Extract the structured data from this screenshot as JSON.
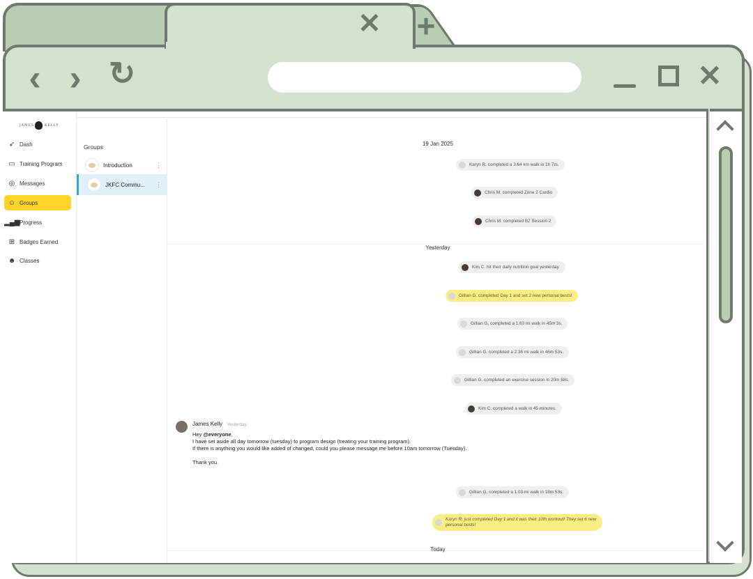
{
  "browser": {
    "tab_close_icon": "close-icon",
    "new_tab_icon": "plus-icon",
    "back_icon": "arrow-left-icon",
    "forward_icon": "arrow-right-icon",
    "reload_icon": "reload-icon",
    "colors": {
      "frame": "#d4e1ce",
      "tab_inactive": "#b9cdb2",
      "outline": "#6d7a6c"
    }
  },
  "app": {
    "logo": {
      "left": "JAMES",
      "right": "KELLY"
    },
    "nav": [
      {
        "label": "Dash",
        "icon": "rocket-icon"
      },
      {
        "label": "Training Program",
        "icon": "folder-icon"
      },
      {
        "label": "Messages",
        "icon": "chat-icon"
      },
      {
        "label": "Groups",
        "icon": "users-icon",
        "active": true
      },
      {
        "label": "Progress",
        "icon": "bar-chart-icon"
      },
      {
        "label": "Badges Earned",
        "icon": "grid-icon"
      },
      {
        "label": "Classes",
        "icon": "people-icon"
      }
    ],
    "accent": "#ffd32a",
    "groups": {
      "title": "Groups",
      "items": [
        {
          "name": "Introduction",
          "selected": false
        },
        {
          "name": "JKFC Commu...",
          "selected": true
        }
      ]
    },
    "feed": {
      "dates": [
        "19 Jan 2025",
        "Yesterday",
        "Today"
      ],
      "activities": [
        "Karyn R. completed a 3.64 km walk in 1h 7m.",
        "Chris M. completed Zone 2 Cardio",
        "Chris M. completed B7 Session 2",
        "Kim C. hit their daily nutrition goal yesterday.",
        "Gillian G. completed Day 1 and set 2 new personal bests!",
        "Gillian G. completed a 1.63 mi walk in 45m 3s.",
        "Gillian G. completed a 2.36 mi walk in 46m 53s.",
        "Gillian G. completed an exercise session in 20m 58s.",
        "Kim C. completed a walk in 45 minutes.",
        "Gillian G. completed a 1.03 mi walk in 18m 53s.",
        "Karyn R. just completed Day 1 and it was their 10th workout! They set 6 new personal bests!"
      ],
      "message": {
        "author": "James Kelly",
        "time": "Yesterday",
        "greeting_prefix": "Hey ",
        "mention": "@everyone",
        "greeting_suffix": ",",
        "line1": "I have set aside all day tomorrow (tuesday) to program design (treating your training program).",
        "line2": "If there is anything you would like added of changed, could you please message me before 10am tomorrow (Tuesday).",
        "signoff": "Thank you."
      }
    }
  }
}
